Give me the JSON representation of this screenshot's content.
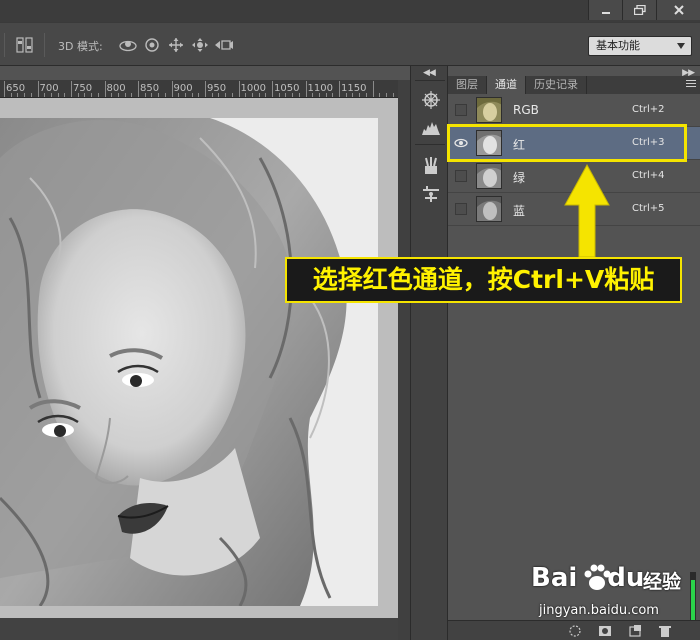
{
  "window": {
    "controls": [
      "minimize",
      "restore",
      "close"
    ]
  },
  "options_bar": {
    "mode_label": "3D 模式:",
    "tools": [
      "orbit-icon",
      "roll-icon",
      "pan-icon",
      "slide-icon",
      "camera-icon"
    ],
    "workspace_value": "基本功能"
  },
  "ruler": {
    "labels": [
      "650",
      "700",
      "750",
      "800",
      "850",
      "900",
      "950",
      "1000",
      "1050",
      "1100",
      "1150"
    ]
  },
  "panel": {
    "tabs": [
      {
        "label": "图层",
        "active": false
      },
      {
        "label": "通道",
        "active": true
      },
      {
        "label": "历史记录",
        "active": false
      }
    ],
    "channels": [
      {
        "name": "RGB",
        "shortcut": "Ctrl+2",
        "visible": false,
        "selected": false
      },
      {
        "name": "红",
        "shortcut": "Ctrl+3",
        "visible": true,
        "selected": true
      },
      {
        "name": "绿",
        "shortcut": "Ctrl+4",
        "visible": false,
        "selected": false
      },
      {
        "name": "蓝",
        "shortcut": "Ctrl+5",
        "visible": false,
        "selected": false
      }
    ]
  },
  "annotation": {
    "text": "选择红色通道，按Ctrl+V粘贴",
    "color": "#f5e400"
  },
  "watermark": {
    "brand": "Bai",
    "brand_du": "du",
    "experience": "经验",
    "url": "jingyan.baidu.com"
  }
}
